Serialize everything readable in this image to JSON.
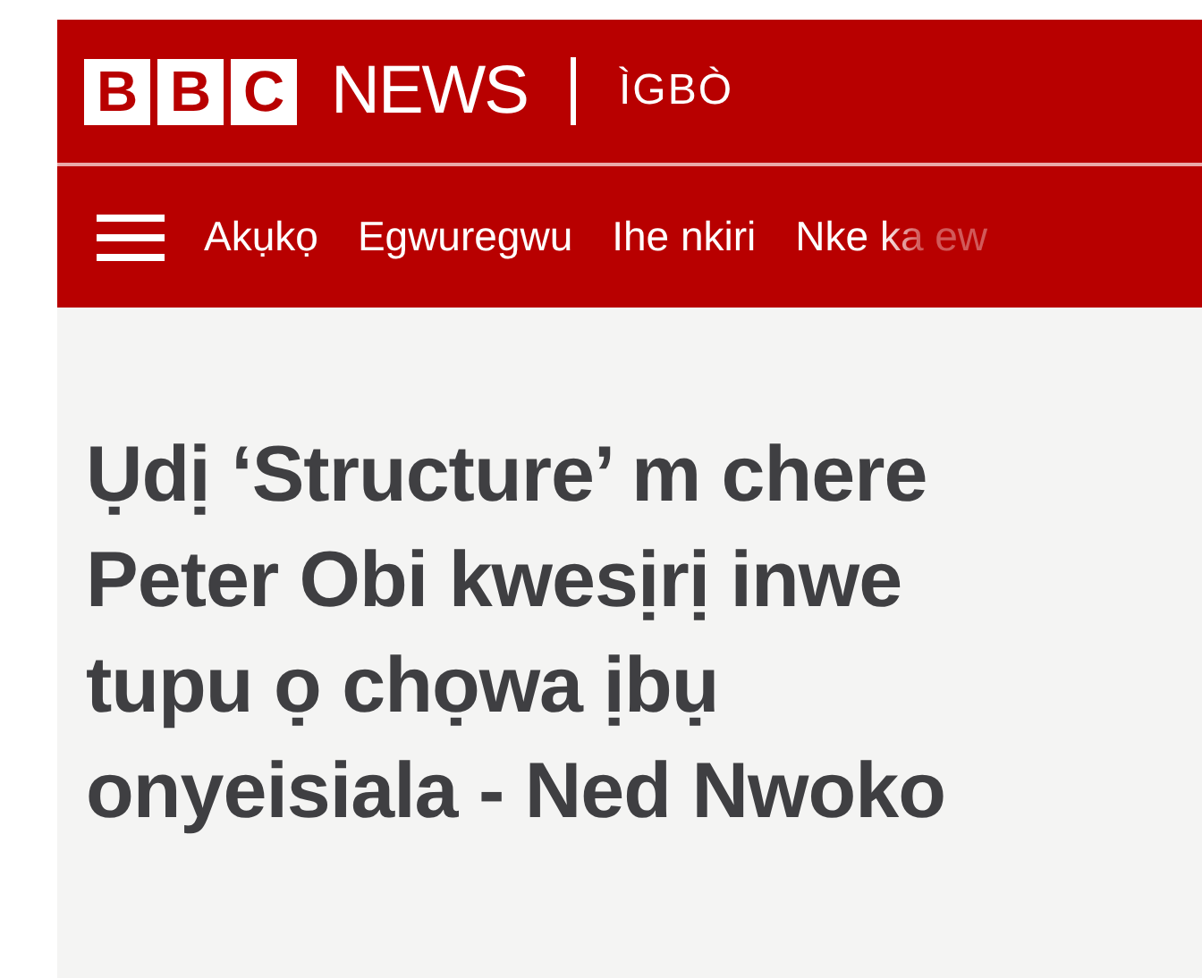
{
  "header": {
    "logo_letters": [
      "B",
      "B",
      "C"
    ],
    "brand": "NEWS",
    "service": "ÌGBÒ"
  },
  "nav": {
    "items": [
      {
        "label": "Akụkọ"
      },
      {
        "label": "Egwuregwu"
      },
      {
        "label": "Ihe nkiri"
      },
      {
        "label": "Nke ka ew",
        "faded": true
      }
    ]
  },
  "article": {
    "headline": "Ụdị ‘Structure’ m chere Peter Obi kwesịrị inwe tupu ọ chọwa ịbụ onyeisiala - Ned Nwoko"
  }
}
